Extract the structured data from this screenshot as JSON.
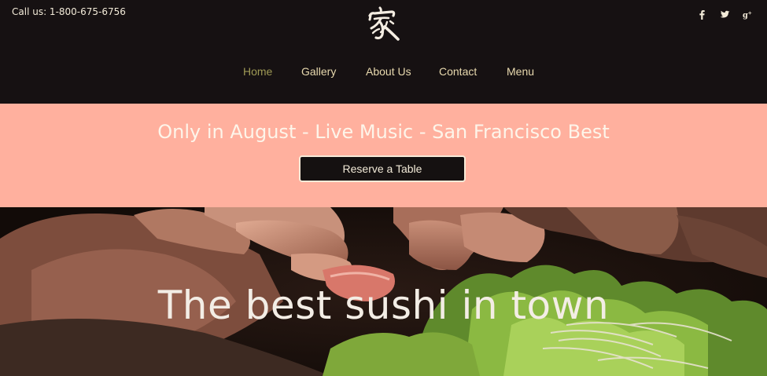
{
  "header": {
    "call_text": "Call us: 1-800-675-6756",
    "logo_icon": "kanji-logo-icon",
    "social": [
      {
        "name": "facebook-icon",
        "glyph": "f"
      },
      {
        "name": "twitter-icon",
        "glyph": "t"
      },
      {
        "name": "google-plus-icon",
        "glyph": "g+"
      }
    ]
  },
  "nav": {
    "items": [
      {
        "label": "Home",
        "active": true
      },
      {
        "label": "Gallery",
        "active": false
      },
      {
        "label": "About Us",
        "active": false
      },
      {
        "label": "Contact",
        "active": false
      },
      {
        "label": "Menu",
        "active": false
      }
    ]
  },
  "promo": {
    "title": "Only in August - Live Music - San Francisco Best",
    "button_label": "Reserve a Table"
  },
  "hero": {
    "title": "The best sushi in town"
  },
  "colors": {
    "header_bg": "#161112",
    "promo_bg": "#ffb09e",
    "nav_text": "#e8d9ae",
    "nav_active": "#9f9a55",
    "button_bg": "#151111"
  }
}
